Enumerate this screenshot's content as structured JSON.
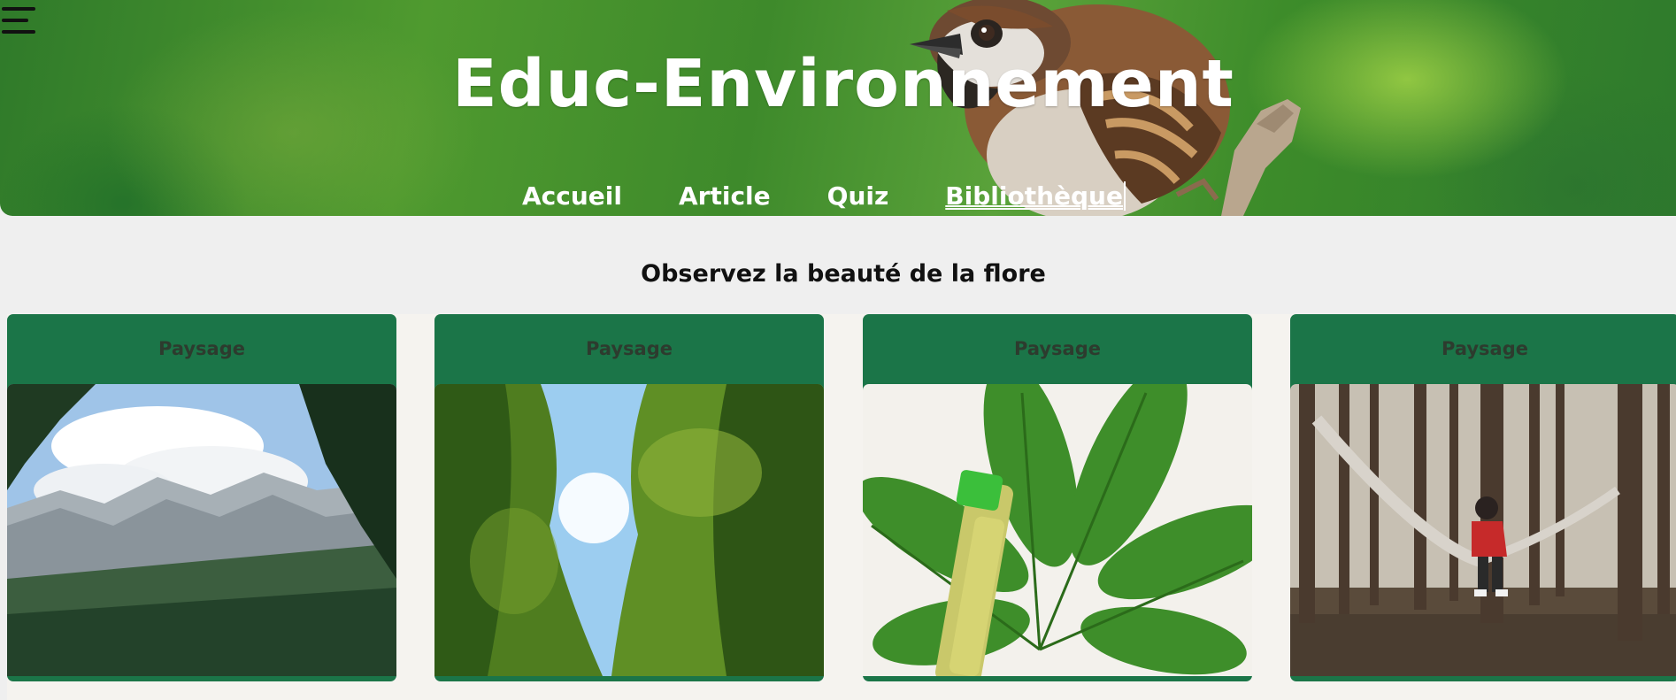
{
  "header": {
    "site_title": "Educ-Environnement",
    "nav": [
      {
        "label": "Accueil"
      },
      {
        "label": "Article"
      },
      {
        "label": "Quiz"
      },
      {
        "label": "Bibliothèque",
        "active": true
      }
    ],
    "menu_icon": "hamburger-menu-icon"
  },
  "main": {
    "section_title": "Observez la beauté de la flore",
    "cards": [
      {
        "title": "Paysage",
        "image": "mountain-landscape"
      },
      {
        "title": "Paysage",
        "image": "forest-canopy-sky"
      },
      {
        "title": "Paysage",
        "image": "chestnut-leaf-with-oil-bottle"
      },
      {
        "title": "Paysage",
        "image": "person-in-hammock-forest"
      }
    ]
  },
  "colors": {
    "card_green": "#1b7548",
    "page_background": "#efefef",
    "header_green": "#4f9a2f"
  }
}
